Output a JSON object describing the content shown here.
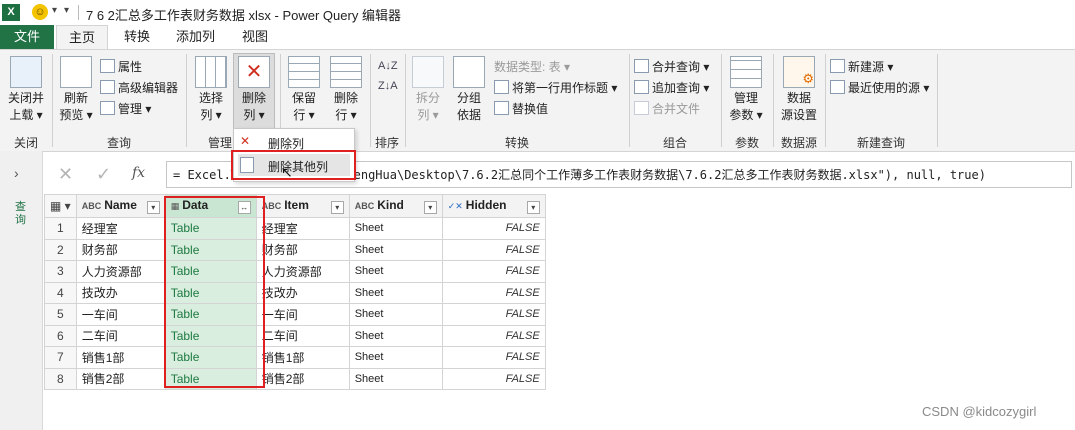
{
  "window": {
    "title": "7 6 2汇总多工作表财务数据 xlsx - Power Query 编辑器",
    "app_icon": "X",
    "quick_access": [
      "▾",
      "▾"
    ]
  },
  "tabs": [
    "文件",
    "主页",
    "转换",
    "添加列",
    "视图"
  ],
  "ribbon": {
    "close": {
      "btn": "关闭并\n上载 ▾",
      "group": "关闭"
    },
    "query": {
      "refresh": "刷新\n预览 ▾",
      "properties": "属性",
      "advanced_editor": "高级编辑器",
      "manage": "管理 ▾",
      "group": "查询"
    },
    "manage_cols": {
      "choose": "选择\n列 ▾",
      "remove": "删除\n列 ▾",
      "group": "管理"
    },
    "reduce_rows": {
      "keep": "保留\n行 ▾",
      "remove": "删除\n行 ▾",
      "group": ""
    },
    "sort": {
      "group": "排序"
    },
    "transform": {
      "split": "拆分\n列 ▾",
      "groupby": "分组\n依据",
      "datatype": "数据类型: 表 ▾",
      "first_row": "将第一行用作标题 ▾",
      "replace": "替换值",
      "group": "转换"
    },
    "combine": {
      "merge": "合并查询 ▾",
      "append": "追加查询 ▾",
      "merge_files": "合并文件",
      "group": "组合"
    },
    "params": {
      "manage": "管理\n参数 ▾",
      "group": "参数"
    },
    "datasource": {
      "settings": "数据\n源设置",
      "group": "数据源"
    },
    "newquery": {
      "new_source": "新建源 ▾",
      "recent": "最近使用的源 ▾",
      "group": "新建查询"
    }
  },
  "dropdown": {
    "remove_col": "删除列",
    "remove_other": "删除其他列"
  },
  "formula": {
    "fx": "fx",
    "text": "= Excel.Wo                  ts(\"C:\\Users\\DengHua\\Desktop\\7.6.2汇总同个工作薄多工作表财务数据\\7.6.2汇总多工作表财务数据.xlsx\"), null, true)"
  },
  "side_label": "查询",
  "table": {
    "columns": [
      "Name",
      "Data",
      "Item",
      "Kind",
      "Hidden"
    ],
    "rows": [
      [
        "1",
        "经理室",
        "Table",
        "经理室",
        "Sheet",
        "FALSE"
      ],
      [
        "2",
        "财务部",
        "Table",
        "财务部",
        "Sheet",
        "FALSE"
      ],
      [
        "3",
        "人力资源部",
        "Table",
        "人力资源部",
        "Sheet",
        "FALSE"
      ],
      [
        "4",
        "技改办",
        "Table",
        "技改办",
        "Sheet",
        "FALSE"
      ],
      [
        "5",
        "一车间",
        "Table",
        "一车间",
        "Sheet",
        "FALSE"
      ],
      [
        "6",
        "二车间",
        "Table",
        "二车间",
        "Sheet",
        "FALSE"
      ],
      [
        "7",
        "销售1部",
        "Table",
        "销售1部",
        "Sheet",
        "FALSE"
      ],
      [
        "8",
        "销售2部",
        "Table",
        "销售2部",
        "Sheet",
        "FALSE"
      ]
    ]
  },
  "watermark": "CSDN @kidcozygirl",
  "colors": {
    "accent": "#217346",
    "highlight": "#e02020",
    "selected_col": "#d9eedf"
  }
}
